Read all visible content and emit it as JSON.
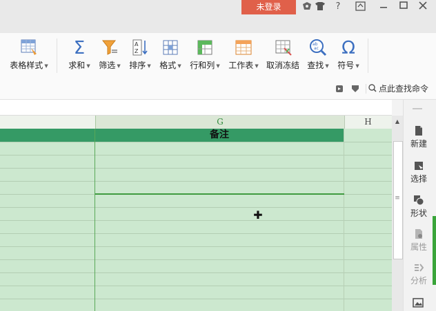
{
  "titlebar": {
    "login_label": "未登录",
    "help_label": "?",
    "icons": [
      "skin-icon",
      "shirt-icon",
      "help-icon",
      "window-restore-icon",
      "minimize-icon",
      "maximize-icon",
      "close-icon"
    ]
  },
  "ribbon": {
    "table_style": "表格样式",
    "sum": "求和",
    "filter": "筛选",
    "sort": "排序",
    "format": "格式",
    "row_col": "行和列",
    "worksheet": "工作表",
    "unfreeze": "取消冻结",
    "find": "查找",
    "symbol": "符号",
    "sum_glyph": "Σ",
    "symbol_glyph": "Ω",
    "cmd_search": "点此查找命令"
  },
  "grid": {
    "columns": [
      "G",
      "H"
    ],
    "notes_header": "备注"
  },
  "scrollbar": {
    "grip": "≡"
  },
  "sidebar": {
    "items": [
      {
        "label": "新建"
      },
      {
        "label": "选择"
      },
      {
        "label": "形状"
      },
      {
        "label": "属性"
      },
      {
        "label": "分析"
      }
    ]
  },
  "colors": {
    "header_band": "#359a65",
    "grid_bg": "#cce8cf",
    "login_bg": "#e0604a",
    "accent_green": "#3aa53a"
  }
}
